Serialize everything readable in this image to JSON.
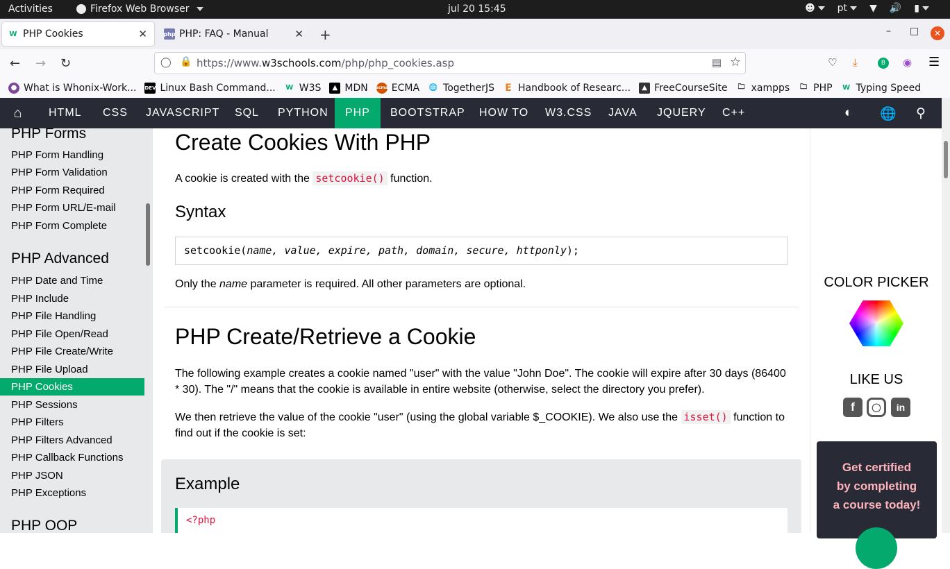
{
  "system": {
    "activities": "Activities",
    "app_name": "Firefox Web Browser",
    "clock": "jul 20  15:45",
    "lang": "pt"
  },
  "tabs": [
    {
      "title": "PHP Cookies",
      "favicon": "w3"
    },
    {
      "title": "PHP: FAQ - Manual",
      "favicon": "php"
    }
  ],
  "url": {
    "prefix": "https://www.",
    "domain": "w3schools.com",
    "path": "/php/php_cookies.asp"
  },
  "bookmarks": [
    {
      "label": "What is Whonix-Work...",
      "icon": "tor"
    },
    {
      "label": "Linux Bash Command...",
      "icon": "dev"
    },
    {
      "label": "W3S",
      "icon": "w3"
    },
    {
      "label": "MDN",
      "icon": "mdn"
    },
    {
      "label": "ECMA",
      "icon": "ecma"
    },
    {
      "label": "TogetherJS",
      "icon": "globe"
    },
    {
      "label": "Handbook of Researc...",
      "icon": "e"
    },
    {
      "label": "FreeCourseSite",
      "icon": "fcs"
    },
    {
      "label": "xampps",
      "icon": "folder"
    },
    {
      "label": "PHP",
      "icon": "folder"
    },
    {
      "label": "Typing Speed",
      "icon": "w3"
    }
  ],
  "w3nav": {
    "items": [
      "HTML",
      "CSS",
      "JAVASCRIPT",
      "SQL",
      "PYTHON",
      "PHP",
      "BOOTSTRAP",
      "HOW TO",
      "W3.CSS",
      "JAVA",
      "JQUERY",
      "C++"
    ],
    "active": "PHP",
    "accent": "#04aa6d",
    "bg": "#282a35"
  },
  "sidebar": {
    "sections": {
      "forms": "PHP Forms",
      "advanced": "PHP Advanced",
      "oop": "PHP OOP"
    },
    "forms_links": [
      "PHP Form Handling",
      "PHP Form Validation",
      "PHP Form Required",
      "PHP Form URL/E-mail",
      "PHP Form Complete"
    ],
    "advanced_links": [
      "PHP Date and Time",
      "PHP Include",
      "PHP File Handling",
      "PHP File Open/Read",
      "PHP File Create/Write",
      "PHP File Upload",
      "PHP Cookies",
      "PHP Sessions",
      "PHP Filters",
      "PHP Filters Advanced",
      "PHP Callback Functions",
      "PHP JSON",
      "PHP Exceptions"
    ],
    "active": "PHP Cookies"
  },
  "main": {
    "h1_create": "Create Cookies With PHP",
    "p1_before": "A cookie is created with the ",
    "p1_code": "setcookie()",
    "p1_after": " function.",
    "h2_syntax": "Syntax",
    "syntax_fn": "setcookie(",
    "syntax_params": "name, value, expire, path, domain, secure, httponly",
    "syntax_end": ");",
    "p2_before": "Only the ",
    "p2_em": "name",
    "p2_after": " parameter is required. All other parameters are optional.",
    "h1_retrieve": "PHP Create/Retrieve a Cookie",
    "p3": "The following example creates a cookie named \"user\" with the value \"John Doe\". The cookie will expire after 30 days (86400 * 30). The \"/\" means that the cookie is available in entire website (otherwise, select the directory you prefer).",
    "p4_before": "We then retrieve the value of the cookie \"user\" (using the global variable $_COOKIE). We also use the ",
    "p4_code": "isset()",
    "p4_after": " function to find out if the cookie is set:",
    "example_title": "Example",
    "example_code_line1": "<?php"
  },
  "right": {
    "color_picker": "COLOR PICKER",
    "like_us": "LIKE US",
    "cert_line1": "Get certified",
    "cert_line2": "by completing",
    "cert_line3": "a course today!"
  }
}
